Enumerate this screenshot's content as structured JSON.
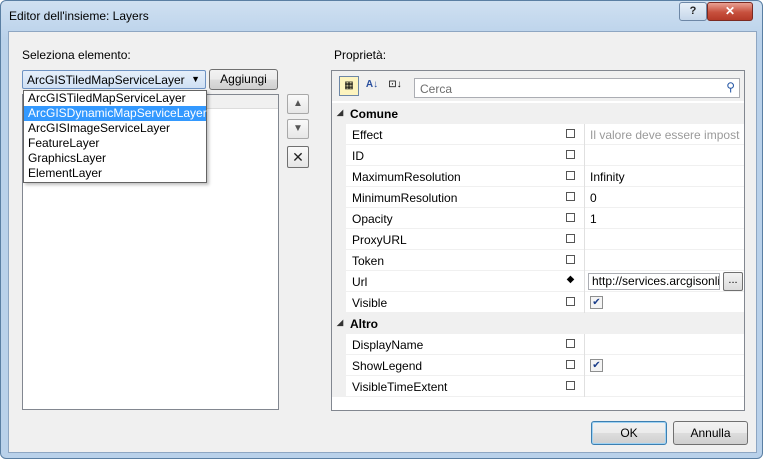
{
  "window": {
    "title": "Editor dell'insieme: Layers",
    "help": "?",
    "close": "✕"
  },
  "left": {
    "select_label": "Seleziona elemento:",
    "combo_value": "ArcGISTiledMapServiceLayer",
    "add_button": "Aggiungi",
    "dropdown_options": [
      {
        "label": "ArcGISTiledMapServiceLayer",
        "selected": false
      },
      {
        "label": "ArcGISDynamicMapServiceLayer",
        "selected": true
      },
      {
        "label": "ArcGISImageServiceLayer",
        "selected": false
      },
      {
        "label": "FeatureLayer",
        "selected": false
      },
      {
        "label": "GraphicsLayer",
        "selected": false
      },
      {
        "label": "ElementLayer",
        "selected": false
      }
    ]
  },
  "properties": {
    "label": "Proprietà:",
    "search_placeholder": "Cerca",
    "categories": [
      {
        "name": "Comune",
        "rows": [
          {
            "name": "Effect",
            "value": "Il valore deve essere impostat",
            "kind": "hint"
          },
          {
            "name": "ID",
            "value": "",
            "kind": "text"
          },
          {
            "name": "MaximumResolution",
            "value": "Infinity",
            "kind": "text"
          },
          {
            "name": "MinimumResolution",
            "value": "0",
            "kind": "text"
          },
          {
            "name": "Opacity",
            "value": "1",
            "kind": "text"
          },
          {
            "name": "ProxyURL",
            "value": "",
            "kind": "text"
          },
          {
            "name": "Token",
            "value": "",
            "kind": "text"
          },
          {
            "name": "Url",
            "value": "http://services.arcgisonli",
            "kind": "url"
          },
          {
            "name": "Visible",
            "value": "✔",
            "kind": "checkbox",
            "checked": true
          }
        ]
      },
      {
        "name": "Altro",
        "rows": [
          {
            "name": "DisplayName",
            "value": "",
            "kind": "text"
          },
          {
            "name": "ShowLegend",
            "value": "✔",
            "kind": "checkbox",
            "checked": true
          },
          {
            "name": "VisibleTimeExtent",
            "value": "",
            "kind": "text"
          }
        ]
      }
    ]
  },
  "footer": {
    "ok": "OK",
    "cancel": "Annulla"
  }
}
